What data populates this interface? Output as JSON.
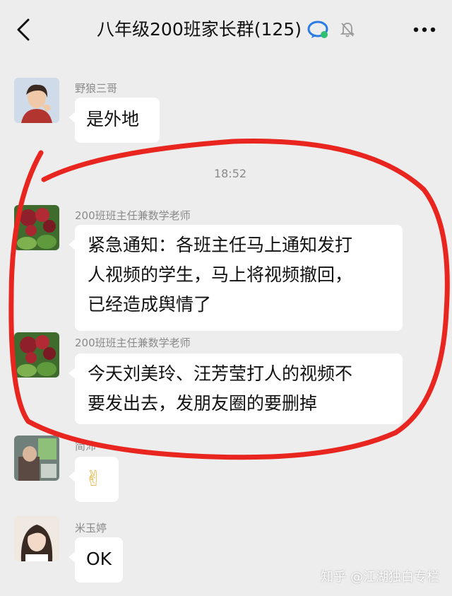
{
  "header": {
    "title": "八年级200班家长群(125)",
    "back_icon": "chevron-left-icon",
    "chat_icon": "chat-bubble-icon",
    "mute_icon": "bell-mute-icon",
    "more_icon": "more-dots-icon"
  },
  "messages": [
    {
      "sender": "野狼三哥",
      "text": "是外地"
    },
    {
      "sender": "200班班主任兼数学老师",
      "lines": [
        "紧急通知：各班主任马上通知发打",
        "人视频的学生，马上将视频撤回，",
        "已经造成舆情了"
      ]
    },
    {
      "sender": "200班班主任兼数学老师",
      "lines": [
        "今天刘美玲、汪芳莹打人的视频不",
        "要发出去，发朋友圈的要删掉"
      ]
    },
    {
      "sender": "简沛",
      "emoji": "✌"
    },
    {
      "sender": "米玉婷",
      "text": "OK"
    }
  ],
  "timestamp": "18:52",
  "watermark": "知乎 @江湖独白专栏",
  "colors": {
    "background": "#ededed",
    "bubble": "#ffffff",
    "annotation": "#e8261f",
    "meta_text": "#8a8a8a"
  }
}
